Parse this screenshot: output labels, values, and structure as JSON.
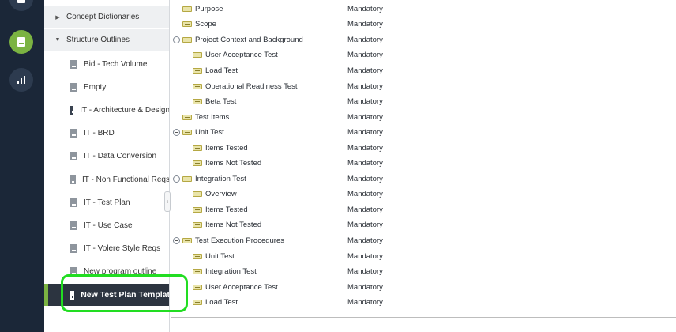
{
  "rail": {
    "items": [
      {
        "icon": "menu-icon"
      },
      {
        "icon": "document-icon",
        "active": true
      },
      {
        "icon": "bar-chart-icon"
      }
    ],
    "accent_color": "#7bb342",
    "background": "#1b2738"
  },
  "sidebar": {
    "folders": [
      {
        "label": "Concept Dictionaries",
        "expanded": false
      },
      {
        "label": "Structure Outlines",
        "expanded": true
      }
    ],
    "items": [
      {
        "label": "Bid - Tech Volume"
      },
      {
        "label": "Empty"
      },
      {
        "label": "IT - Architecture & Design"
      },
      {
        "label": "IT - BRD"
      },
      {
        "label": "IT - Data Conversion"
      },
      {
        "label": "IT - Non Functional Reqs"
      },
      {
        "label": "IT - Test Plan"
      },
      {
        "label": "IT - Use Case"
      },
      {
        "label": "IT - Volere Style Reqs"
      },
      {
        "label": "New program outline"
      },
      {
        "label": "New Test Plan Templat",
        "selected": true
      }
    ],
    "highlight_color": "#22dd22"
  },
  "outline": {
    "rows": [
      {
        "label": "Purpose",
        "level": 0,
        "toggle": false,
        "status": "Mandatory"
      },
      {
        "label": "Scope",
        "level": 0,
        "toggle": false,
        "status": "Mandatory"
      },
      {
        "label": "Project Context and Background",
        "level": 0,
        "toggle": true,
        "status": "Mandatory"
      },
      {
        "label": "User Acceptance Test",
        "level": 1,
        "toggle": false,
        "status": "Mandatory"
      },
      {
        "label": "Load Test",
        "level": 1,
        "toggle": false,
        "status": "Mandatory"
      },
      {
        "label": "Operational Readiness Test",
        "level": 1,
        "toggle": false,
        "status": "Mandatory"
      },
      {
        "label": "Beta Test",
        "level": 1,
        "toggle": false,
        "status": "Mandatory"
      },
      {
        "label": "Test Items",
        "level": 0,
        "toggle": false,
        "status": "Mandatory"
      },
      {
        "label": "Unit Test",
        "level": 0,
        "toggle": true,
        "status": "Mandatory"
      },
      {
        "label": "Items Tested",
        "level": 1,
        "toggle": false,
        "status": "Mandatory"
      },
      {
        "label": "Items Not Tested",
        "level": 1,
        "toggle": false,
        "status": "Mandatory"
      },
      {
        "label": "Integration Test",
        "level": 0,
        "toggle": true,
        "status": "Mandatory"
      },
      {
        "label": "Overview",
        "level": 1,
        "toggle": false,
        "status": "Mandatory"
      },
      {
        "label": "Items Tested",
        "level": 1,
        "toggle": false,
        "status": "Mandatory"
      },
      {
        "label": "Items Not Tested",
        "level": 1,
        "toggle": false,
        "status": "Mandatory"
      },
      {
        "label": "Test Execution Procedures",
        "level": 0,
        "toggle": true,
        "status": "Mandatory"
      },
      {
        "label": "Unit Test",
        "level": 1,
        "toggle": false,
        "status": "Mandatory"
      },
      {
        "label": "Integration Test",
        "level": 1,
        "toggle": false,
        "status": "Mandatory"
      },
      {
        "label": "User Acceptance Test",
        "level": 1,
        "toggle": false,
        "status": "Mandatory"
      },
      {
        "label": "Load Test",
        "level": 1,
        "toggle": false,
        "status": "Mandatory"
      }
    ]
  }
}
